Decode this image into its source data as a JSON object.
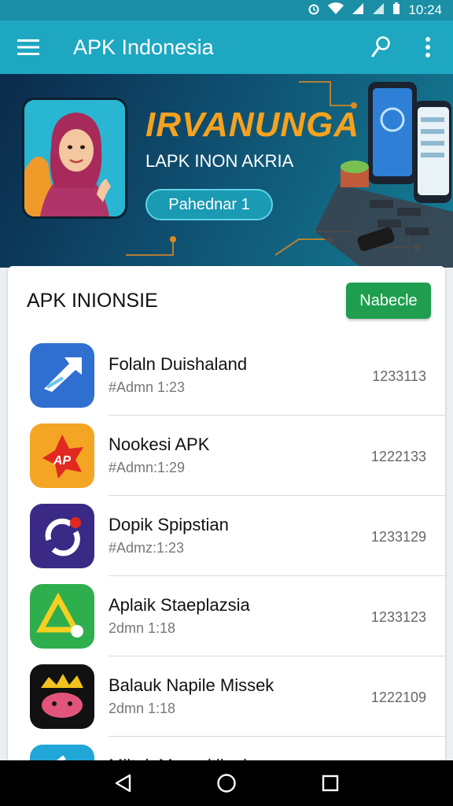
{
  "status": {
    "time": "10:24"
  },
  "appbar": {
    "title": "APK Indonesia"
  },
  "banner": {
    "title": "IRVANUNGA",
    "subtitle": "LAPK INON AKRIA",
    "button_label": "Pahednar 1"
  },
  "section": {
    "title": "APK INIONSIE",
    "button_label": "Nabecle"
  },
  "apps": [
    {
      "name": "Folaln Duishaland",
      "sub": "#Admn 1:23",
      "num": "1233113",
      "color": "#2f6fd0"
    },
    {
      "name": "Nookesi APK",
      "sub": "#Admn:1:29",
      "num": "1222133",
      "color": "#f4a524"
    },
    {
      "name": "Dopik Spipstian",
      "sub": "#Admz:1:23",
      "num": "1233129",
      "color": "#3a2a86"
    },
    {
      "name": "Aplaik Staeplazsia",
      "sub": "2dmn 1:18",
      "num": "1233123",
      "color": "#2fae4e"
    },
    {
      "name": "Balauk Napile Missek",
      "sub": "2dmn 1:18",
      "num": "1222109",
      "color": "#111111"
    },
    {
      "name": "Miltak Maeraltijeak",
      "sub": "",
      "num": "",
      "color": "#21a6d8"
    }
  ],
  "colors": {
    "appbar": "#1ea7c1",
    "statusbar": "#1b8fa6",
    "accent_green": "#1e9e4e"
  }
}
